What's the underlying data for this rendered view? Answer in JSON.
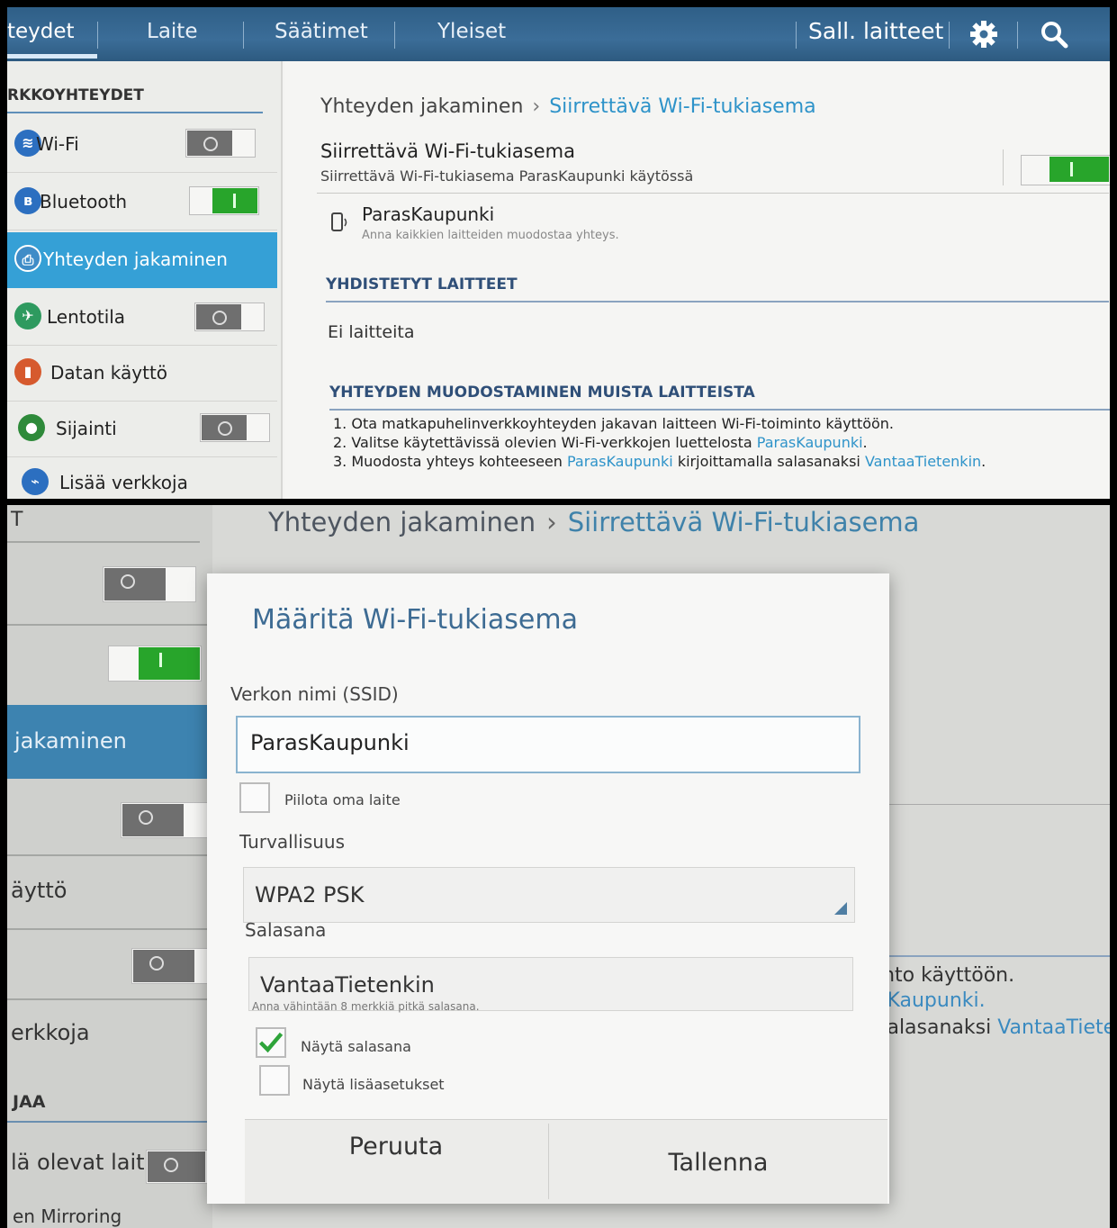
{
  "top": {
    "tabs": [
      "teydet",
      "Laite",
      "Säätimet",
      "Yleiset"
    ],
    "allowed_devices": "Sall. laitteet",
    "sidebar": {
      "header": "RKKOYHTEYDET",
      "items": [
        {
          "label": "Wi-Fi",
          "icon": "wifi-icon",
          "toggle": "off"
        },
        {
          "label": "Bluetooth",
          "icon": "bluetooth-icon",
          "toggle": "on"
        },
        {
          "label": "Yhteyden jakaminen",
          "icon": "tethering-icon",
          "selected": true
        },
        {
          "label": "Lentotila",
          "icon": "airplane-icon",
          "toggle": "off"
        },
        {
          "label": "Datan käyttö",
          "icon": "data-usage-icon"
        },
        {
          "label": "Sijainti",
          "icon": "location-icon",
          "toggle": "off"
        },
        {
          "label": "Lisää verkkoja",
          "icon": "more-networks-icon"
        }
      ]
    },
    "content": {
      "breadcrumb_parent": "Yhteyden jakaminen",
      "breadcrumb_current": "Siirrettävä Wi-Fi-tukiasema",
      "hotspot_title": "Siirrettävä Wi-Fi-tukiasema",
      "hotspot_status": "Siirrettävä Wi-Fi-tukiasema ParasKaupunki käytössä",
      "network_name": "ParasKaupunki",
      "network_hint": "Anna kaikkien laitteiden muodostaa yhteys.",
      "connected_header": "YHDISTETYT LAITTEET",
      "no_devices": "Ei laitteita",
      "connect_header": "YHTEYDEN MUODOSTAMINEN MUISTA LAITTEISTA",
      "step1": "1. Ota matkapuhelinverkkoyhteyden jakavan laitteen Wi-Fi-toiminto käyttöön.",
      "step2_a": "2. Valitse käytettävissä olevien Wi-Fi-verkkojen luettelosta ",
      "step2_link": "ParasKaupunki",
      "step2_b": ".",
      "step3_a": "3. Muodosta yhteys kohteeseen ",
      "step3_link": "ParasKaupunki",
      "step3_b": " kirjoittamalla salasanaksi ",
      "step3_link2": "VantaaTietenkin",
      "step3_c": "."
    }
  },
  "bottom": {
    "breadcrumb_parent": "Yhteyden jakaminen",
    "breadcrumb_current": "Siirrettävä Wi-Fi-tukiasema",
    "bg_sidebar": {
      "t": "T",
      "jakaminen": "jakaminen",
      "kaytto": "äyttö",
      "verkkoja": "erkkoja",
      "jaa": "JAA",
      "olevat": "lä olevat lait.",
      "mirroring": "en Mirroring"
    },
    "bg_text": {
      "line1": "into käyttöön.",
      "line2": "sKaupunki.",
      "line3_a": "salasanaksi ",
      "line3_b": "VantaaTiete"
    },
    "dialog": {
      "title": "Määritä Wi-Fi-tukiasema",
      "ssid_label": "Verkon nimi (SSID)",
      "ssid_value": "ParasKaupunki",
      "hide_label": "Piilota oma laite",
      "hide_checked": false,
      "security_label": "Turvallisuus",
      "security_value": "WPA2 PSK",
      "password_label": "Salasana",
      "password_value": "VantaaTietenkin",
      "password_hint": "Anna vähintään 8 merkkiä pitkä salasana.",
      "show_password_label": "Näytä salasana",
      "show_password_checked": true,
      "show_advanced_label": "Näytä lisäasetukset",
      "show_advanced_checked": false,
      "cancel": "Peruuta",
      "save": "Tallenna"
    }
  },
  "colors": {
    "accent_blue": "#2e93c9",
    "selected_blue": "#35a0d6",
    "toggle_green": "#28a52b",
    "titlebar": "#3b6d98"
  }
}
